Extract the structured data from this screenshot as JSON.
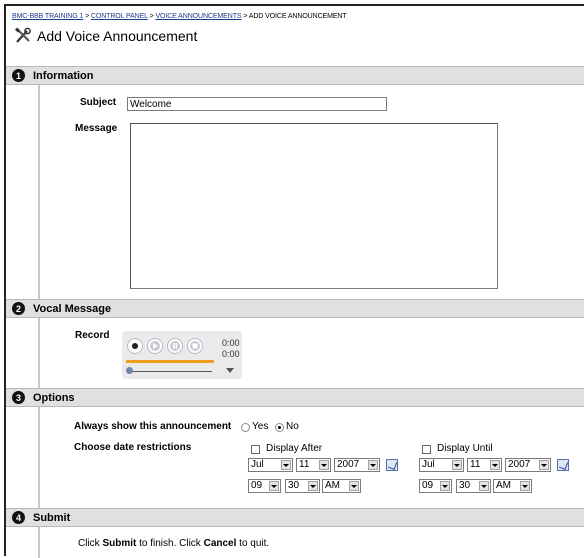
{
  "breadcrumb": {
    "items": [
      "BMC-BBB TRAINING 1",
      "CONTROL PANEL",
      "VOICE ANNOUNCEMENTS"
    ],
    "current": "ADD VOICE ANNOUNCEMENT",
    "separator": ">"
  },
  "page_title": "Add Voice Announcement",
  "sections": [
    {
      "number": "1",
      "title": "Information"
    },
    {
      "number": "2",
      "title": "Vocal Message"
    },
    {
      "number": "3",
      "title": "Options"
    },
    {
      "number": "4",
      "title": "Submit"
    }
  ],
  "information": {
    "subject_label": "Subject",
    "subject_value": "Welcome",
    "message_label": "Message",
    "message_value": ""
  },
  "vocal": {
    "record_label": "Record",
    "time_elapsed": "0:00",
    "time_total": "0:00",
    "progress": 0
  },
  "options": {
    "always_label": "Always show this announcement",
    "yes_label": "Yes",
    "no_label": "No",
    "selected": "No",
    "date_label": "Choose date restrictions",
    "display_after": {
      "label": "Display After",
      "checked": false,
      "month": "Jul",
      "day": "11",
      "year": "2007",
      "hour": "09",
      "minute": "30",
      "ampm": "AM"
    },
    "display_until": {
      "label": "Display Until",
      "checked": false,
      "month": "Jul",
      "day": "11",
      "year": "2007",
      "hour": "09",
      "minute": "30",
      "ampm": "AM"
    }
  },
  "submit": {
    "p1": "Click ",
    "submit_word": "Submit",
    "p2": " to finish. Click ",
    "cancel_word": "Cancel",
    "p3": " to quit."
  },
  "colors": {
    "section_bar": "#e0e0e0",
    "link": "#1a3d8c",
    "recorder_progress": "#f0a020"
  },
  "icons": {
    "title": "tools-icon",
    "record": "record-icon",
    "play": "play-icon",
    "pause": "pause-icon",
    "stop": "stop-icon",
    "calendar": "calendar-icon"
  }
}
